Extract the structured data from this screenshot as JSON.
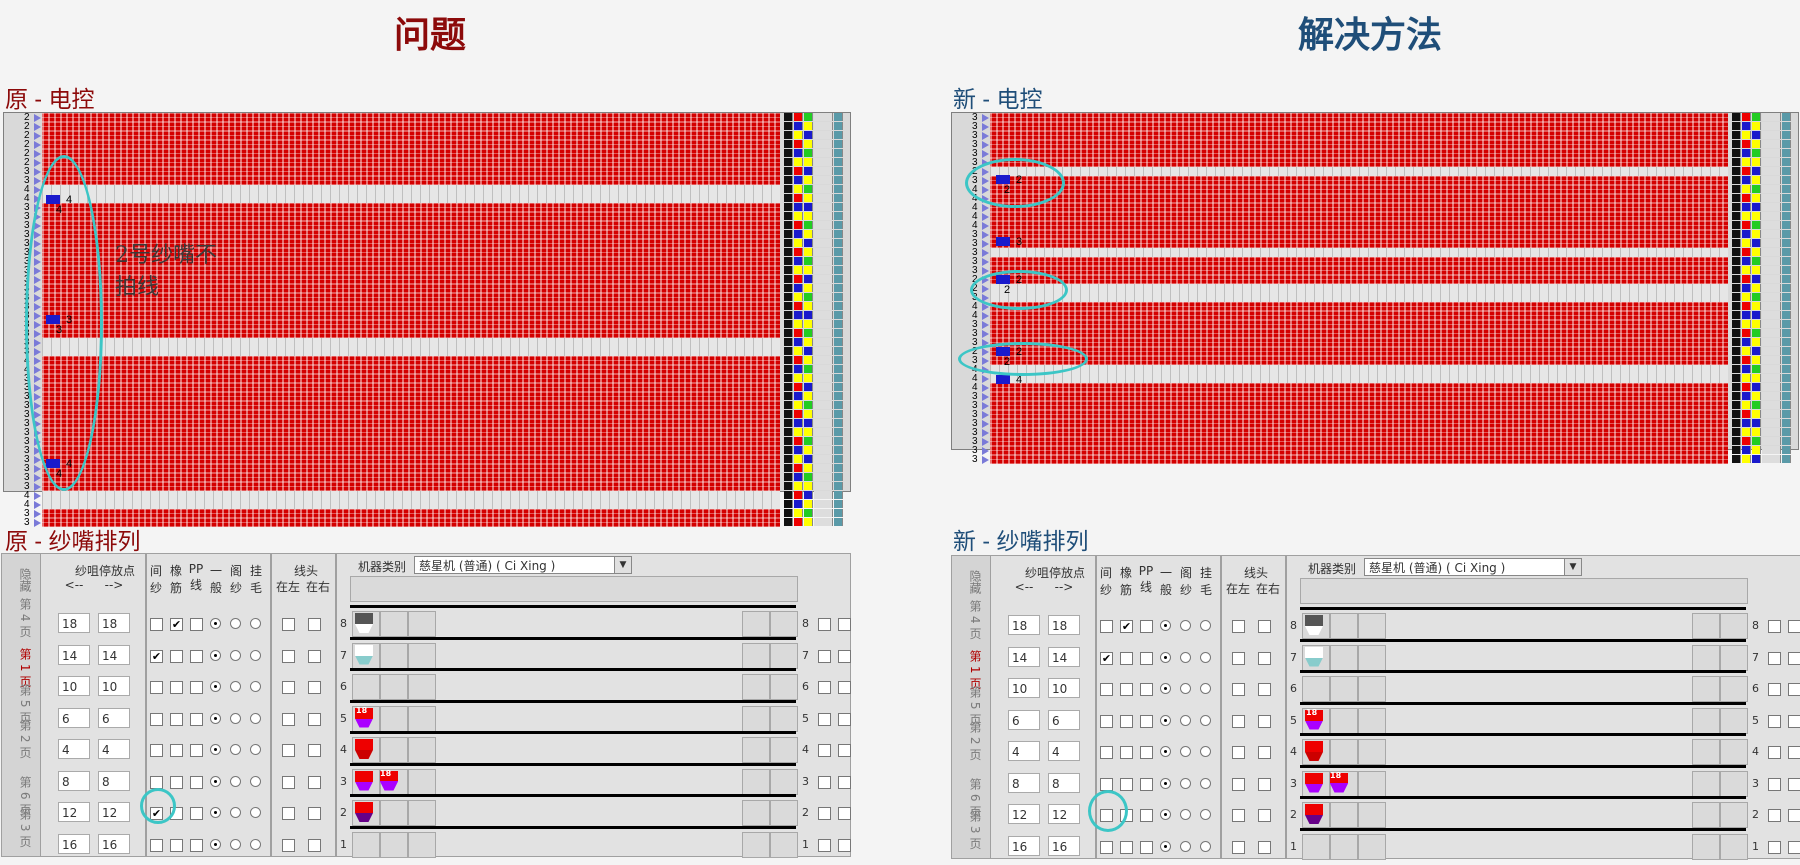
{
  "headings": {
    "problem": "问题",
    "solution": "解决方法"
  },
  "sections": {
    "orig_control": "原 - 电控",
    "new_control": "新 - 电控",
    "orig_feeders": "原 - 纱嘴排列",
    "new_feeders": "新 - 纱嘴排列"
  },
  "annotation": {
    "line1": "2号纱嘴不",
    "line2": "拍线"
  },
  "panel_labels": {
    "feeder_stop_point": "纱咀停放点",
    "arrow_left": "<--",
    "arrow_right": "-->",
    "intermittent_line1": "间",
    "intermittent_line2": "纱",
    "elastic_line1": "橡",
    "elastic_line2": "筋",
    "pp_line1": "PP",
    "pp_line2": "线",
    "general_line1": "一",
    "general_line2": "般",
    "tuck_line1": "阁",
    "tuck_line2": "纱",
    "hang_line1": "挂",
    "hang_line2": "毛",
    "thread_head": "线头",
    "at_left": "在左",
    "at_right": "在右",
    "machine_type": "机器类别",
    "machine_value": "慈星机 (普通) ( Ci Xing )"
  },
  "page_tabs": [
    "隐藏",
    "第 4 页",
    "第 1 页",
    "第 5 页",
    "第 2 页",
    "第 6 页",
    "第 3 页"
  ],
  "feeder_rows": [
    {
      "row": "8",
      "left": "18",
      "right": "18"
    },
    {
      "row": "7",
      "left": "14",
      "right": "14"
    },
    {
      "row": "6",
      "left": "10",
      "right": "10"
    },
    {
      "row": "5",
      "left": "6",
      "right": "6"
    },
    {
      "row": "4",
      "left": "4",
      "right": "4"
    },
    {
      "row": "3",
      "left": "8",
      "right": "8"
    },
    {
      "row": "2",
      "left": "12",
      "right": "12"
    },
    {
      "row": "1",
      "left": "16",
      "right": "16"
    }
  ],
  "yarn_labels": {
    "r5": "18",
    "r3": "18"
  },
  "orig_strip_labels": {
    "a": "4",
    "b": "4",
    "c": "3",
    "d": "3",
    "e": "4",
    "f": "4"
  },
  "new_strip_labels": {
    "a": "2",
    "b": "2",
    "c": "3",
    "d": "2",
    "e": "2",
    "f": "2",
    "g": "2",
    "h": "4"
  },
  "colors": {
    "accent_red": "#8c0a0a",
    "accent_blue": "#1f4e79",
    "highlight": "#3cc6c6"
  }
}
